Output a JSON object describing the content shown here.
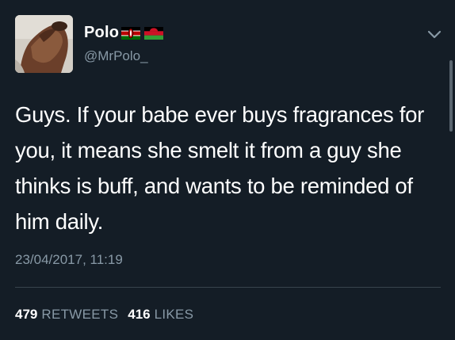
{
  "author": {
    "display_name": "Polo",
    "handle": "@MrPolo_",
    "flags": [
      "kenya-flag",
      "malawi-flag"
    ]
  },
  "tweet": {
    "text": "Guys. If your babe ever buys fragrances for you, it means she smelt it from a guy she thinks is buff, and wants to be reminded of him daily.",
    "timestamp": "23/04/2017, 11:19"
  },
  "stats": {
    "retweets_count": "479",
    "retweets_label": "RETWEETS",
    "likes_count": "416",
    "likes_label": "LIKES"
  },
  "icons": {
    "menu": "chevron-down-icon"
  },
  "colors": {
    "background": "#141d26",
    "primary_text": "#ffffff",
    "secondary_text": "#8899a6",
    "divider": "#38444d"
  }
}
